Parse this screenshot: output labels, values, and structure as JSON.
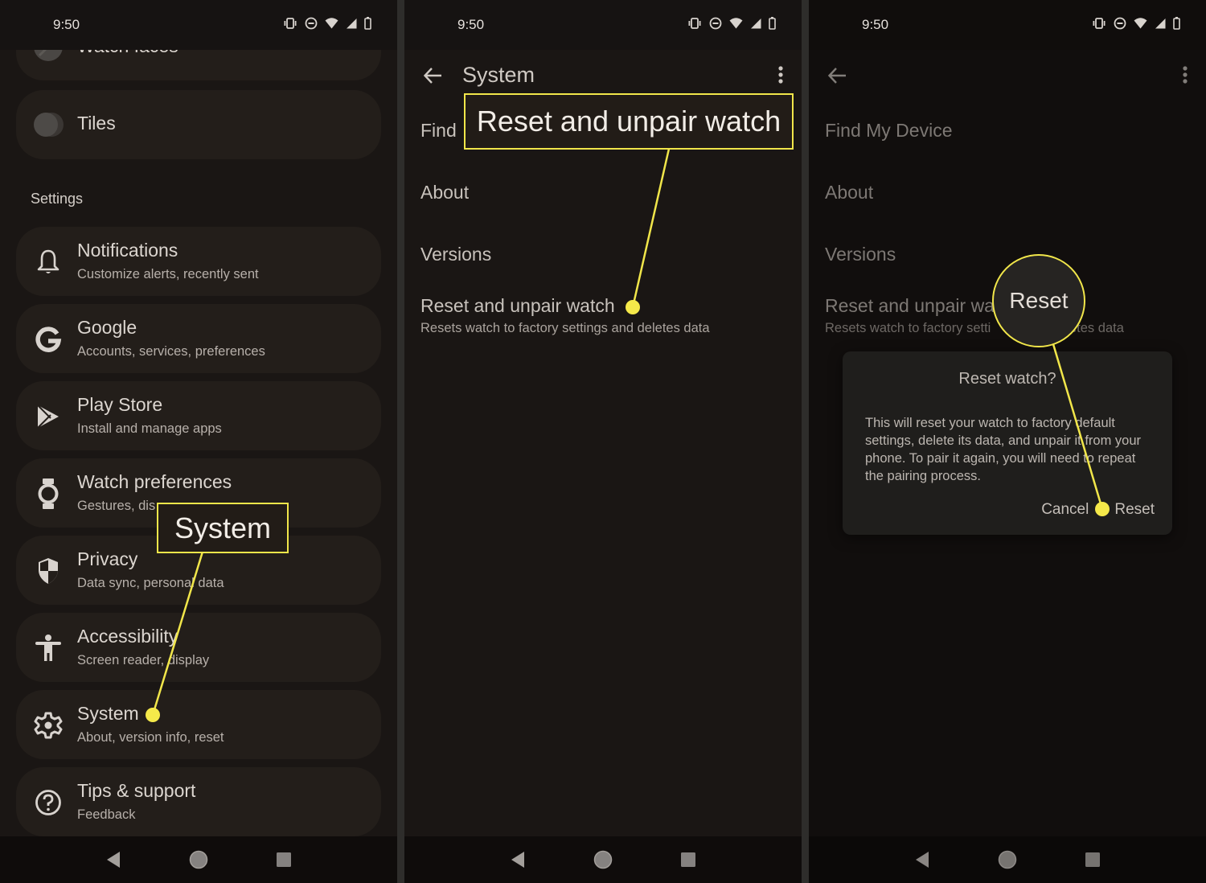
{
  "status_bar": {
    "time": "9:50",
    "icons": [
      "vibrate-icon",
      "do-not-disturb-icon",
      "wifi-icon",
      "cellular-signal-icon",
      "battery-icon"
    ]
  },
  "nav_bar": {
    "icons": [
      "back-triangle-icon",
      "home-circle-icon",
      "recents-square-icon"
    ]
  },
  "accent_color": "#f1e64a",
  "panel1": {
    "partial_top_item": "Watch faces",
    "tiles_label": "Tiles",
    "section_label": "Settings",
    "items": [
      {
        "icon": "bell-icon",
        "title": "Notifications",
        "subtitle": "Customize alerts, recently sent"
      },
      {
        "icon": "google-g-icon",
        "title": "Google",
        "subtitle": "Accounts, services, preferences"
      },
      {
        "icon": "play-store-icon",
        "title": "Play Store",
        "subtitle": "Install and manage apps"
      },
      {
        "icon": "watch-icon",
        "title": "Watch preferences",
        "subtitle": "Gestures, dis"
      },
      {
        "icon": "shield-icon",
        "title": "Privacy",
        "subtitle": "Data sync, personal data"
      },
      {
        "icon": "accessibility-icon",
        "title": "Accessibility",
        "subtitle": "Screen reader, display"
      },
      {
        "icon": "gear-icon",
        "title": "System",
        "subtitle": "About, version info, reset"
      },
      {
        "icon": "help-icon",
        "title": "Tips & support",
        "subtitle": "Feedback"
      }
    ],
    "callout": "System"
  },
  "panel2": {
    "title": "System",
    "items": {
      "find": "Find",
      "about": "About",
      "versions": "Versions",
      "reset": "Reset and unpair watch",
      "reset_sub": "Resets watch to factory settings and deletes data"
    },
    "callout": "Reset and unpair watch"
  },
  "panel3": {
    "items": {
      "find": "Find My Device",
      "about": "About",
      "versions": "Versions",
      "reset": "Reset and unpair wa",
      "reset_sub_a": "Resets watch to factory setti",
      "reset_sub_b": "etes data"
    },
    "dialog": {
      "title": "Reset watch?",
      "body": "This will reset your watch to factory default settings, delete its data, and unpair it from your phone. To pair it again, you will need to repeat the pairing process.",
      "cancel": "Cancel",
      "confirm": "Reset"
    },
    "callout": "Reset"
  }
}
